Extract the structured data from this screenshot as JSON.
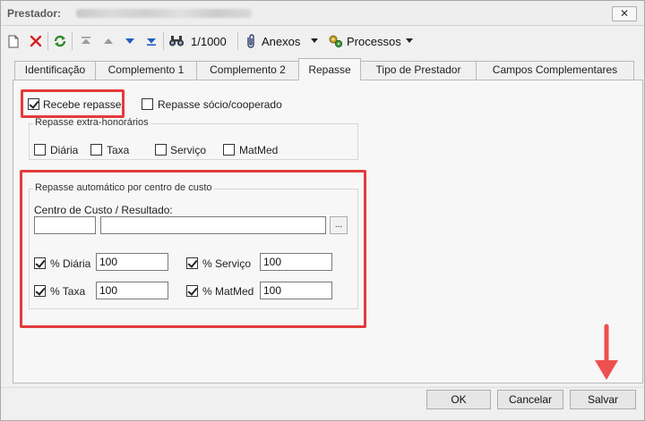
{
  "window": {
    "title": "Prestador:",
    "close_glyph": "✕"
  },
  "toolbar": {
    "record_counter": "1/1000",
    "anexos_label": "Anexos",
    "processos_label": "Processos",
    "icons": [
      "new-document-icon",
      "delete-icon",
      "refresh-icon",
      "first-record-icon",
      "previous-record-icon",
      "next-record-icon",
      "last-record-icon",
      "search-binoculars-icon",
      "paperclip-icon",
      "processes-icon"
    ]
  },
  "tabs": [
    {
      "label": "Identificação",
      "active": false
    },
    {
      "label": "Complemento 1",
      "active": false
    },
    {
      "label": "Complemento 2",
      "active": false
    },
    {
      "label": "Repasse",
      "active": true
    },
    {
      "label": "Tipo de Prestador",
      "active": false
    },
    {
      "label": "Campos Complementares",
      "active": false
    }
  ],
  "repasse": {
    "recebe_repasse": {
      "label": "Recebe repasse",
      "checked": true
    },
    "repasse_socio": {
      "label": "Repasse sócio/cooperado",
      "checked": false
    },
    "extra": {
      "legend": "Repasse extra-honorários",
      "options": [
        {
          "label": "Diária",
          "checked": false
        },
        {
          "label": "Taxa",
          "checked": false
        },
        {
          "label": "Serviço",
          "checked": false
        },
        {
          "label": "MatMed",
          "checked": false
        }
      ]
    },
    "auto": {
      "legend": "Repasse automático por centro de custo",
      "centro_label": "Centro de Custo / Resultado:",
      "centro_code": "",
      "centro_desc": "",
      "lookup_label": "...",
      "percent": [
        {
          "label": "% Diária",
          "checked": true,
          "value": "100"
        },
        {
          "label": "% Serviço",
          "checked": true,
          "value": "100"
        },
        {
          "label": "% Taxa",
          "checked": true,
          "value": "100"
        },
        {
          "label": "% MatMed",
          "checked": true,
          "value": "100"
        }
      ]
    }
  },
  "footer": {
    "ok_label": "OK",
    "cancel_label": "Cancelar",
    "save_label": "Salvar"
  },
  "colors": {
    "highlight": "#e23b3b",
    "arrow": "#ee4f4f",
    "refresh_green": "#2e8b2e",
    "delete_red": "#d62020",
    "nav_blue": "#1f5fbf"
  }
}
